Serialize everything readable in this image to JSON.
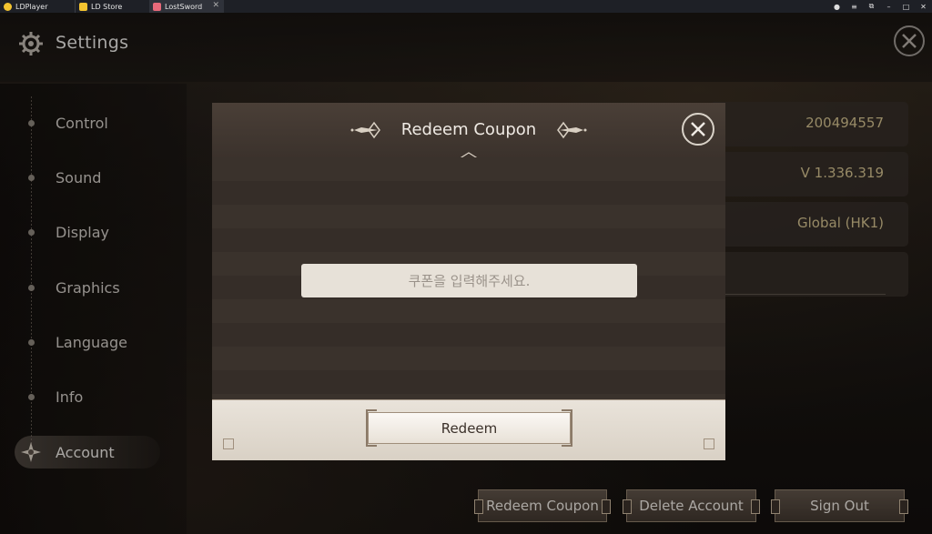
{
  "tabs": [
    {
      "label": "LDPlayer",
      "icon": "ldplayer-logo-icon",
      "color": "#f4c430"
    },
    {
      "label": "LD Store",
      "icon": "ld-store-icon",
      "color": "#f4c430"
    },
    {
      "label": "LostSword",
      "icon": "lostsword-app-icon",
      "color": "#e86a7a",
      "active": true
    }
  ],
  "header": {
    "title": "Settings"
  },
  "sidebar": {
    "items": [
      {
        "label": "Control"
      },
      {
        "label": "Sound"
      },
      {
        "label": "Display"
      },
      {
        "label": "Graphics"
      },
      {
        "label": "Language"
      },
      {
        "label": "Info"
      },
      {
        "label": "Account",
        "active": true
      }
    ]
  },
  "info": {
    "values": [
      "200494557",
      "V 1.336.319",
      "Global (HK1)"
    ]
  },
  "buttons": {
    "redeem_coupon": "Redeem Coupon",
    "delete_account": "Delete Account",
    "sign_out": "Sign Out"
  },
  "modal": {
    "title": "Redeem Coupon",
    "input_placeholder": "쿠폰을 입력해주세요.",
    "redeem_label": "Redeem"
  },
  "colors": {
    "accent_gold": "#d1bf8e",
    "panel": "#3a322c"
  }
}
